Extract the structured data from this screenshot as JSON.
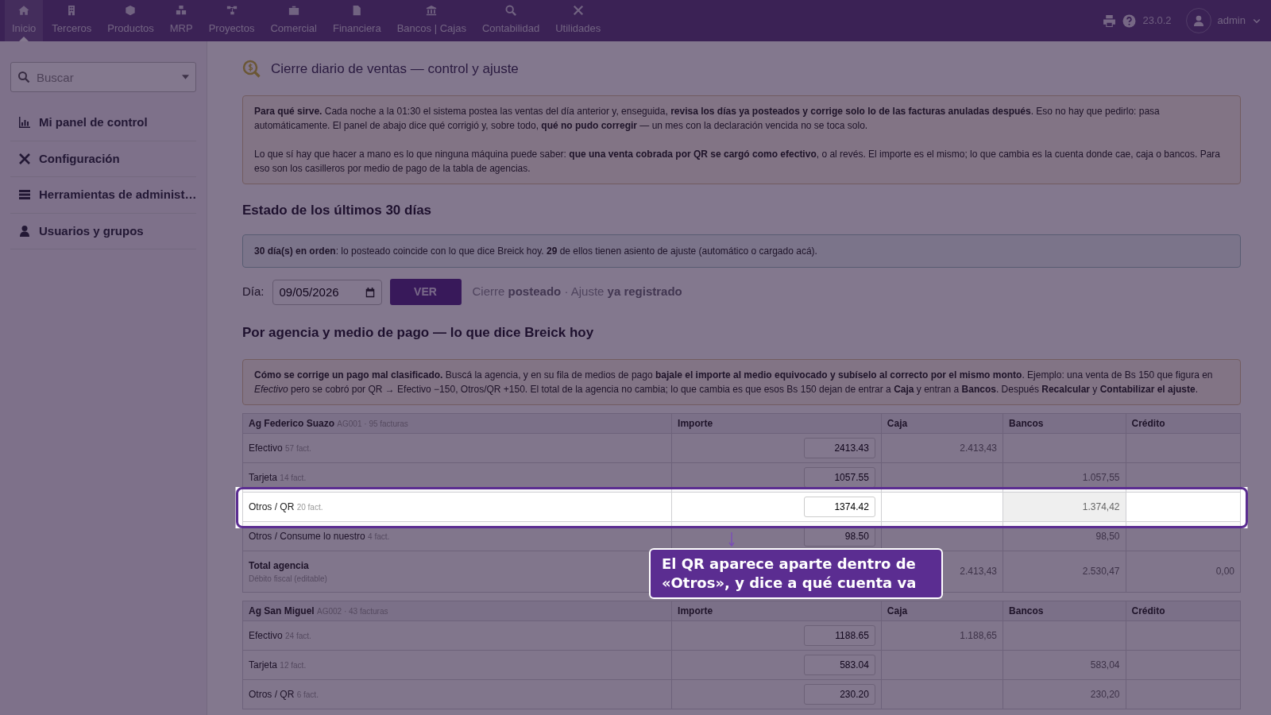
{
  "nav": {
    "items": [
      {
        "label": "Inicio",
        "selected": true
      },
      {
        "label": "Terceros",
        "selected": false
      },
      {
        "label": "Productos",
        "selected": false
      },
      {
        "label": "MRP",
        "selected": false
      },
      {
        "label": "Proyectos",
        "selected": false
      },
      {
        "label": "Comercial",
        "selected": false
      },
      {
        "label": "Financiera",
        "selected": false
      },
      {
        "label": "Bancos | Cajas",
        "selected": false
      },
      {
        "label": "Contabilidad",
        "selected": false
      },
      {
        "label": "Utilidades",
        "selected": false
      }
    ],
    "version": "23.0.2",
    "user": "admin"
  },
  "sidebar": {
    "search": {
      "placeholder": "Buscar"
    },
    "items": [
      {
        "label": "Mi panel de control"
      },
      {
        "label": "Configuración"
      },
      {
        "label": "Herramientas de administ…"
      },
      {
        "label": "Usuarios y grupos"
      }
    ]
  },
  "page": {
    "title": "Cierre diario de ventas — control y ajuste",
    "intro": [
      "**Para qué sirve.** Cada noche a la 01:30 el sistema postea las ventas del día anterior y, enseguida, **revisa los días ya posteados y corrige solo lo de las facturas anuladas después**. Eso no hay que pedirlo: pasa automáticamente. El panel de abajo dice qué corrigió y, sobre todo, **qué no pudo corregir** — un mes con la declaración vencida no se toca solo.",
      "Lo que sí hay que hacer a mano es lo que ninguna máquina puede saber: **que una venta cobrada por QR se cargó como efectivo**, o al revés. El importe es el mismo; lo que cambia es la cuenta donde cae, caja o bancos. Para eso son los casilleros por medio de pago de la tabla de agencias."
    ]
  },
  "status": {
    "heading": "Estado de los últimos 30 días",
    "message": "**30 día(s) en orden**: lo posteado coincide con lo que dice Breick hoy. **29** de ellos tienen asiento de ajuste (automático o cargado acá).",
    "day_label": "Día:",
    "day_value": "09/05/2026",
    "view_button": "VER",
    "state_text": "Cierre **posteado** · Ajuste **ya registrado**"
  },
  "agencies": {
    "heading": "Por agencia y medio de pago — lo que dice Breick hoy",
    "help": "**Cómo se corrige un pago mal clasificado.** Buscá la agencia, y en su fila de medios de pago **bajale el importe al medio equivocado y subíselo al correcto por el mismo monto**. Ejemplo: una venta de Bs 150 que figura en *Efectivo* pero se cobró por QR → Efectivo −150, Otros/QR +150. El total de la agencia no cambia; lo que cambia es que esos Bs 150 dejan de entrar a **Caja** y entran a **Bancos**. Después **Recalcular** y **Contabilizar el ajuste**.",
    "tables": [
      {
        "name": "Ag Federico Suazo",
        "meta": "AG001 · 95 facturas",
        "columns": [
          "Importe",
          "Caja",
          "Bancos",
          "Crédito"
        ],
        "rows": [
          {
            "method": "Efectivo",
            "count": "57 fact.",
            "amount": "2413.43",
            "caja": "2.413,43",
            "highlighted": false
          },
          {
            "method": "Tarjeta",
            "count": "14 fact.",
            "amount": "1057.55",
            "bancos": "1.057,55",
            "highlighted": false
          },
          {
            "method": "Otros / QR",
            "count": "20 fact.",
            "amount": "1374.42",
            "bancos": "1.374,42",
            "highlighted": true
          },
          {
            "method": "Otros / Consume lo nuestro",
            "count": "4 fact.",
            "amount": "98.50",
            "bancos": "98,50",
            "highlighted": false
          }
        ],
        "total": {
          "label": "Total agencia",
          "sub": "Débito fiscal (editable)",
          "caja": "2.413,43",
          "bancos": "2.530,47",
          "credito": "0,00"
        }
      },
      {
        "name": "Ag San Miguel",
        "meta": "AG002 · 43 facturas",
        "columns": [
          "Importe",
          "Caja",
          "Bancos",
          "Crédito"
        ],
        "rows": [
          {
            "method": "Efectivo",
            "count": "24 fact.",
            "amount": "1188.65",
            "caja": "1.188,65",
            "highlighted": false
          },
          {
            "method": "Tarjeta",
            "count": "12 fact.",
            "amount": "583.04",
            "bancos": "583,04",
            "highlighted": false
          },
          {
            "method": "Otros / QR",
            "count": "6 fact.",
            "amount": "230.20",
            "bancos": "230,20",
            "highlighted": false
          }
        ]
      }
    ]
  },
  "callout": {
    "text": "El QR aparece aparte dentro de «Otros», y dice a qué cuenta va"
  }
}
